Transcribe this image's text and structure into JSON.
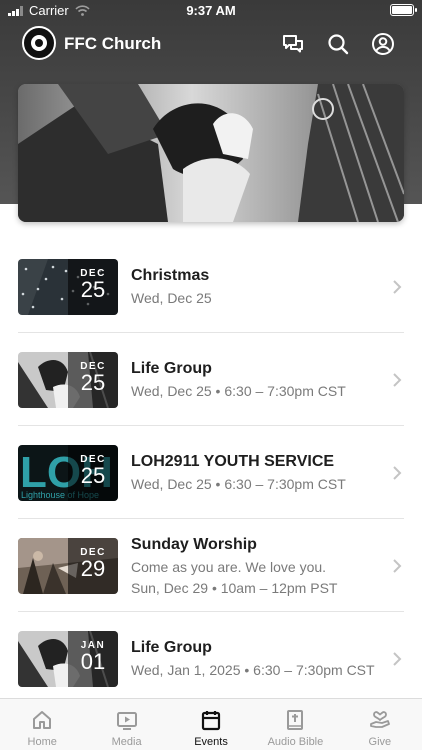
{
  "status_bar": {
    "carrier": "Carrier",
    "time": "9:37 AM"
  },
  "header": {
    "app_title": "FFC Church"
  },
  "events": [
    {
      "title": "Christmas",
      "lines": [
        "Wed, Dec 25"
      ],
      "month": "DEC",
      "day": "25",
      "thumb": "starry"
    },
    {
      "title": "Life Group",
      "lines": [
        "Wed, Dec 25 • 6:30 – 7:30pm CST"
      ],
      "month": "DEC",
      "day": "25",
      "thumb": "hands"
    },
    {
      "title": "LOH2911 YOUTH SERVICE",
      "lines": [
        "Wed, Dec 25 • 6:30 – 7:30pm CST"
      ],
      "month": "DEC",
      "day": "25",
      "thumb": "teal",
      "thumb_text": "LOH",
      "thumb_subtext": "Lighthouse of Hope"
    },
    {
      "title": "Sunday Worship",
      "lines": [
        "Come as you are. We love you.",
        "Sun, Dec 29 • 10am – 12pm PST"
      ],
      "month": "DEC",
      "day": "29",
      "thumb": "worship"
    },
    {
      "title": "Life Group",
      "lines": [
        "Wed, Jan 1, 2025 • 6:30 – 7:30pm CST"
      ],
      "month": "JAN",
      "day": "01",
      "thumb": "hands"
    }
  ],
  "tabs": [
    {
      "label": "Home",
      "icon": "home-icon"
    },
    {
      "label": "Media",
      "icon": "media-icon"
    },
    {
      "label": "Events",
      "icon": "calendar-icon",
      "active": true
    },
    {
      "label": "Audio Bible",
      "icon": "bible-icon"
    },
    {
      "label": "Give",
      "icon": "give-icon"
    }
  ],
  "colors": {
    "header_bg": "#444444",
    "accent": "#111111",
    "inactive": "#9a9a9a",
    "teal": "#2fa0a8"
  }
}
